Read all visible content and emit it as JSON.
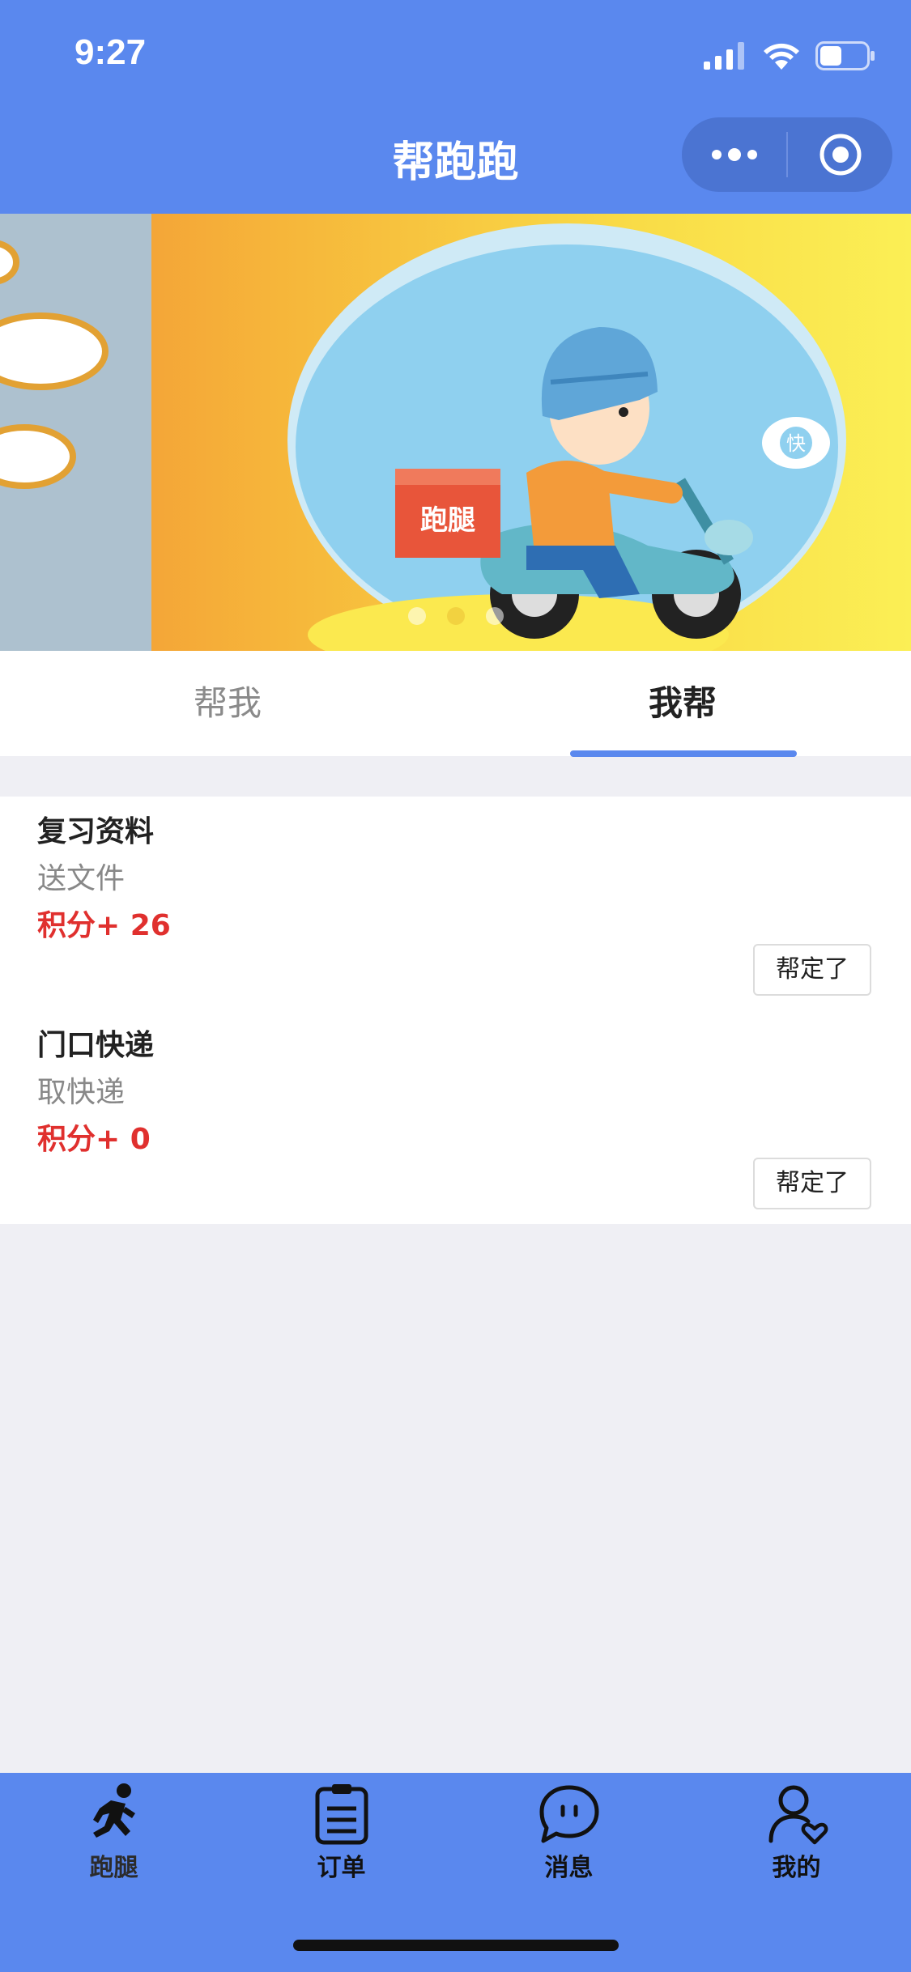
{
  "status_bar": {
    "time": "9:27"
  },
  "nav": {
    "title": "帮跑跑"
  },
  "banner": {
    "box_text": "跑腿",
    "bubble_text": "快",
    "dots": 3,
    "active_dot": 1
  },
  "tabs": [
    {
      "label": "帮我",
      "active": false
    },
    {
      "label": "我帮",
      "active": true
    }
  ],
  "orders": [
    {
      "title": "复习资料",
      "type": "送文件",
      "points": "积分+ 26",
      "button": "帮定了"
    },
    {
      "title": "门口快递",
      "type": "取快递",
      "points": "积分+ 0",
      "button": "帮定了"
    }
  ],
  "tabbar": [
    {
      "label": "跑腿",
      "icon": "runner-icon",
      "active": true
    },
    {
      "label": "订单",
      "icon": "clipboard-icon",
      "active": false
    },
    {
      "label": "消息",
      "icon": "chat-bubble-icon",
      "active": false
    },
    {
      "label": "我的",
      "icon": "user-heart-icon",
      "active": false
    }
  ],
  "colors": {
    "primary": "#5a88ee",
    "points": "#e0302e",
    "page_background": "#efeff4"
  }
}
